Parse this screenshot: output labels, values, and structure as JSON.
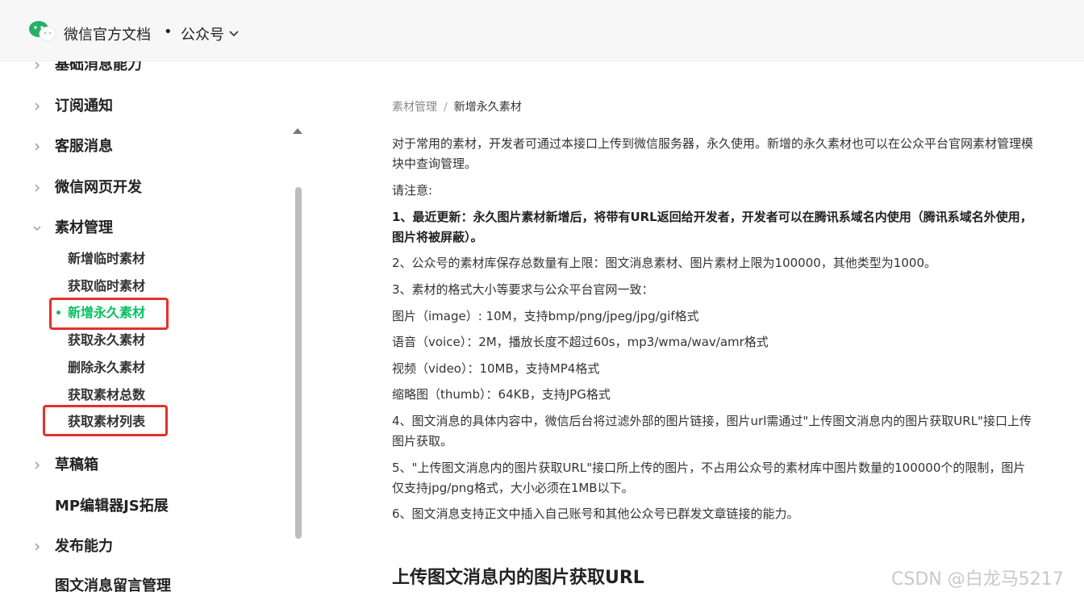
{
  "header": {
    "brand": "微信官方文档",
    "dot": "•",
    "section": "公众号"
  },
  "sidebar": {
    "items": [
      {
        "label": "基础消息能力"
      },
      {
        "label": "订阅通知"
      },
      {
        "label": "客服消息"
      },
      {
        "label": "微信网页开发"
      },
      {
        "label": "素材管理"
      },
      {
        "label": "草稿箱"
      },
      {
        "label": "MP编辑器JS拓展"
      },
      {
        "label": "发布能力"
      },
      {
        "label": "图文消息留言管理"
      }
    ],
    "subitems": [
      {
        "label": "新增临时素材"
      },
      {
        "label": "获取临时素材"
      },
      {
        "label": "新增永久素材"
      },
      {
        "label": "获取永久素材"
      },
      {
        "label": "删除永久素材"
      },
      {
        "label": "获取素材总数"
      },
      {
        "label": "获取素材列表"
      }
    ]
  },
  "breadcrumb": {
    "parent": "素材管理",
    "sep": "/",
    "current": "新增永久素材"
  },
  "content": {
    "p1": "对于常用的素材，开发者可通过本接口上传到微信服务器，永久使用。新增的永久素材也可以在公众平台官网素材管理模块中查询管理。",
    "p2": "请注意:",
    "p3": "1、最近更新：永久图片素材新增后，将带有URL返回给开发者，开发者可以在腾讯系域名内使用（腾讯系域名外使用，图片将被屏蔽）。",
    "p4": "2、公众号的素材库保存总数量有上限：图文消息素材、图片素材上限为100000，其他类型为1000。",
    "p5": "3、素材的格式大小等要求与公众平台官网一致：",
    "p6": "图片（image）: 10M，支持bmp/png/jpeg/jpg/gif格式",
    "p7": "语音（voice）：2M，播放长度不超过60s，mp3/wma/wav/amr格式",
    "p8": "视频（video）：10MB，支持MP4格式",
    "p9": "缩略图（thumb）：64KB，支持JPG格式",
    "p10": "4、图文消息的具体内容中，微信后台将过滤外部的图片链接，图片url需通过\"上传图文消息内的图片获取URL\"接口上传图片获取。",
    "p11": "5、\"上传图文消息内的图片获取URL\"接口所上传的图片，不占用公众号的素材库中图片数量的100000个的限制，图片仅支持jpg/png格式，大小必须在1MB以下。",
    "p12": "6、图文消息支持正文中插入自己账号和其他公众号已群发文章链接的能力。",
    "h2": "上传图文消息内的图片获取URL"
  },
  "watermark": "CSDN @白龙马5217",
  "colors": {
    "accent": "#07c160",
    "highlight_box": "#e4302a"
  }
}
